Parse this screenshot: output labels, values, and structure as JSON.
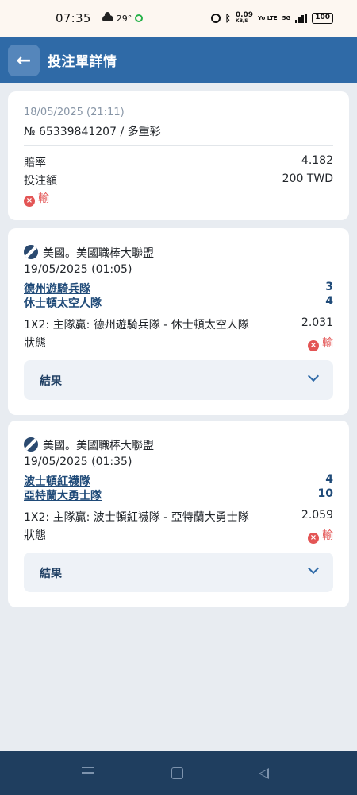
{
  "status_bar": {
    "time": "07:35",
    "temperature": "29°",
    "net_speed": "0.09",
    "net_unit": "KB/S",
    "network_tag": "Yo LTE",
    "signal": "5G",
    "battery": "100"
  },
  "header": {
    "back_icon": "arrow-left-icon",
    "title": "投注單詳情"
  },
  "summary": {
    "datetime": "18/05/2025 (21:11)",
    "ticket": "№ 65339841207 / 多重彩",
    "odds_label": "賠率",
    "odds_value": "4.182",
    "stake_label": "投注額",
    "stake_value": "200 TWD",
    "status_text": "輸"
  },
  "legs": [
    {
      "league": "美國。美國職棒大聯盟",
      "datetime": "19/05/2025 (01:05)",
      "home_team": "德州遊騎兵隊",
      "home_score": "3",
      "away_team": "休士頓太空人隊",
      "away_score": "4",
      "market": "1X2: 主隊贏: 德州遊騎兵隊 - 休士頓太空人隊",
      "odds": "2.031",
      "status_label": "狀態",
      "status_text": "輸",
      "result_label": "結果"
    },
    {
      "league": "美國。美國職棒大聯盟",
      "datetime": "19/05/2025 (01:35)",
      "home_team": "波士頓紅襪隊",
      "home_score": "4",
      "away_team": "亞特蘭大勇士隊",
      "away_score": "10",
      "market": "1X2: 主隊贏: 波士頓紅襪隊 - 亞特蘭大勇士隊",
      "odds": "2.059",
      "status_label": "狀態",
      "status_text": "輸",
      "result_label": "結果"
    }
  ],
  "colors": {
    "header_bg": "#2f6aa7",
    "loss_red": "#e35555",
    "team_blue": "#1f4a78",
    "nav_bg": "#1f3e5f"
  }
}
